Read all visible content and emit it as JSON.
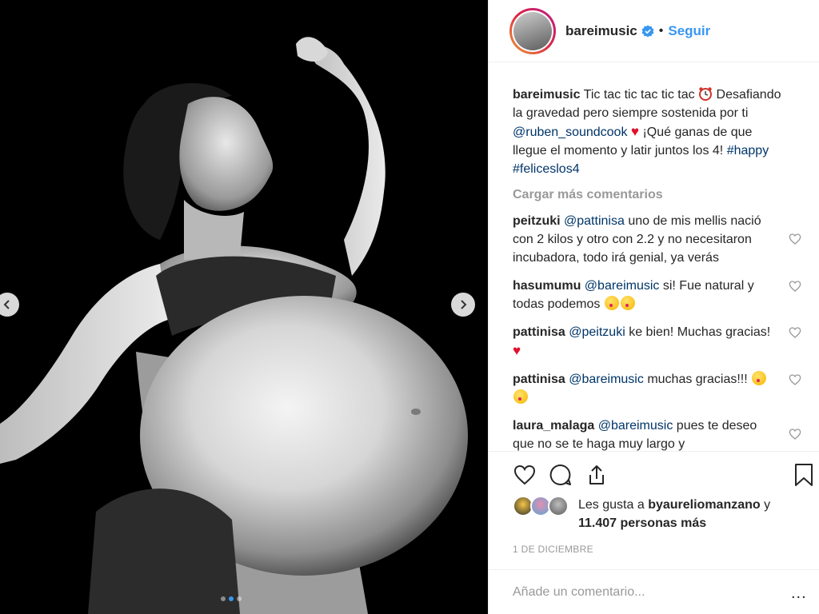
{
  "post": {
    "username": "bareimusic",
    "follow_label": "Seguir",
    "separator": "•",
    "caption_text": "Tic tac tic tac tic tac",
    "caption_line2": "Desafiando la gravedad pero siempre sostenida por ti",
    "caption_mention": "@ruben_soundcook",
    "caption_line3": "¡Qué ganas de que llegue el momento y latir juntos los 4!",
    "caption_tag1": "#happy",
    "caption_tag2": "#feliceslos4",
    "load_more": "Cargar más comentarios"
  },
  "comments": [
    {
      "user": "peitzuki",
      "mention": "@pattinisa",
      "text": "uno de mis mellis nació con 2 kilos y otro con 2.2 y no necesitaron incubadora, todo irá genial, ya verás"
    },
    {
      "user": "hasumumu",
      "mention": "@bareimusic",
      "text": "si! Fue natural y todas podemos"
    },
    {
      "user": "pattinisa",
      "mention": "@peitzuki",
      "text": "ke bien! Muchas gracias!"
    },
    {
      "user": "pattinisa",
      "mention": "@bareimusic",
      "text": "muchas gracias!!!"
    },
    {
      "user": "laura_malaga",
      "mention": "@bareimusic",
      "text": "pues te deseo que no se te haga muy largo y"
    }
  ],
  "likes": {
    "prefix": "Les gusta a",
    "user": "byaureliomanzano",
    "suffix": "y",
    "count_text": "11.407 personas más"
  },
  "date": "1 DE DICIEMBRE",
  "add_comment_placeholder": "Añade un comentario...",
  "more_label": "...",
  "icons": {
    "like": "heart-icon",
    "comment": "comment-icon",
    "share": "share-icon",
    "save": "bookmark-icon",
    "verified": "verified-badge-icon"
  },
  "colors": {
    "link": "#003569",
    "accent": "#3897f0",
    "muted": "#999999"
  },
  "carousel": {
    "slide_count": 3,
    "active_index": 1
  }
}
